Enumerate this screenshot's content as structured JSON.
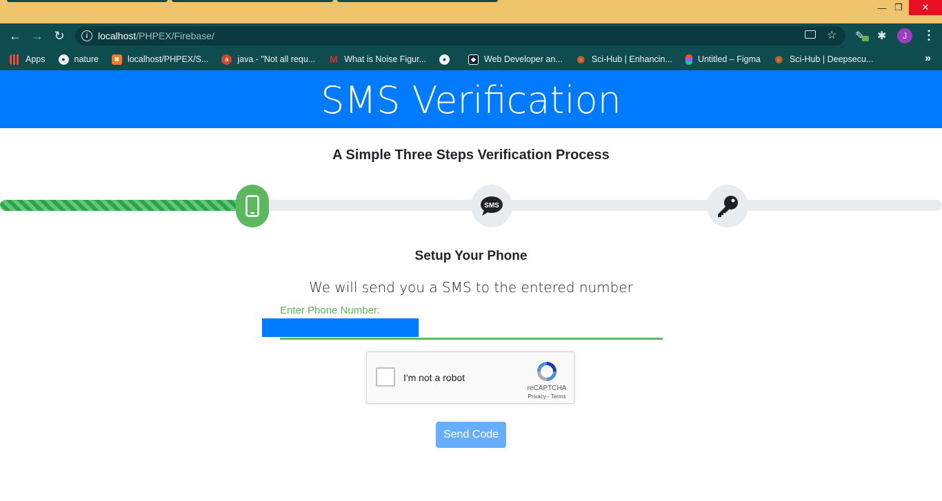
{
  "browser": {
    "url_host": "localhost",
    "url_path": "/PHPEX/Firebase/",
    "profile_initial": "J",
    "bookmarks": [
      {
        "label": "Apps",
        "icon": "apps-grid-icon"
      },
      {
        "label": "nature",
        "icon": "globe-icon"
      },
      {
        "label": "localhost/PHPEX/S...",
        "icon": "xampp-icon"
      },
      {
        "label": "java - \"Not all requ...",
        "icon": "ask-icon"
      },
      {
        "label": "What is Noise Figur...",
        "icon": "m-logo-icon"
      },
      {
        "label": "",
        "icon": "globe-icon"
      },
      {
        "label": "Web Developer an...",
        "icon": "freecodecamp-icon"
      },
      {
        "label": "Sci-Hub | Enhancin...",
        "icon": "scihub-icon"
      },
      {
        "label": "Untitled – Figma",
        "icon": "figma-icon"
      },
      {
        "label": "Sci-Hub | Deepsecu...",
        "icon": "scihub-icon"
      }
    ]
  },
  "page": {
    "header_title": "SMS Verification",
    "subtitle": "A Simple Three Steps Verification Process",
    "progress_fraction": 0.27,
    "steps": [
      {
        "icon": "mobile-phone-icon",
        "active": true
      },
      {
        "icon": "sms-bubble-icon",
        "label": "SMS",
        "active": false
      },
      {
        "icon": "key-icon",
        "active": false
      }
    ],
    "section_title": "Setup Your Phone",
    "lead": "We will send you a SMS to the entered number",
    "phone_label": "Enter Phone Number:",
    "phone_value": "",
    "recaptcha": {
      "label": "I'm not a robot",
      "brand": "reCAPTCHA",
      "links": "Privacy - Terms"
    },
    "send_button": "Send Code"
  },
  "colors": {
    "header_bg": "#007bff",
    "success": "#5cb85c",
    "browser_chrome": "#0e4c50",
    "titlebar": "#efc46b"
  }
}
